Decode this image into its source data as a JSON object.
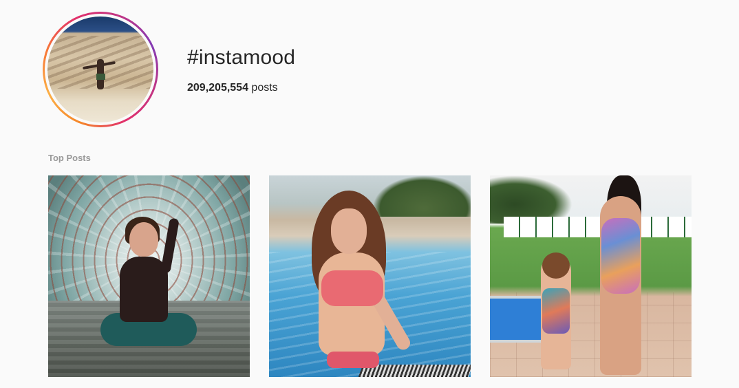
{
  "hashtag": {
    "title": "#instamood",
    "post_count": "209,205,554",
    "post_count_suffix": " posts"
  },
  "sections": {
    "top_posts_label": "Top Posts"
  },
  "top_posts": [
    {
      "description": "Woman sitting cross-legged in a tunnel walkway"
    },
    {
      "description": "Woman in pink swimsuit in a pool"
    },
    {
      "description": "Woman and child in swimsuits by a pool"
    }
  ],
  "colors": {
    "background": "#fafafa",
    "text": "#262626",
    "muted": "#999999",
    "ring_gradient": [
      "#f58529",
      "#fcaf45",
      "#e1306c",
      "#c13584",
      "#833ab4"
    ]
  }
}
